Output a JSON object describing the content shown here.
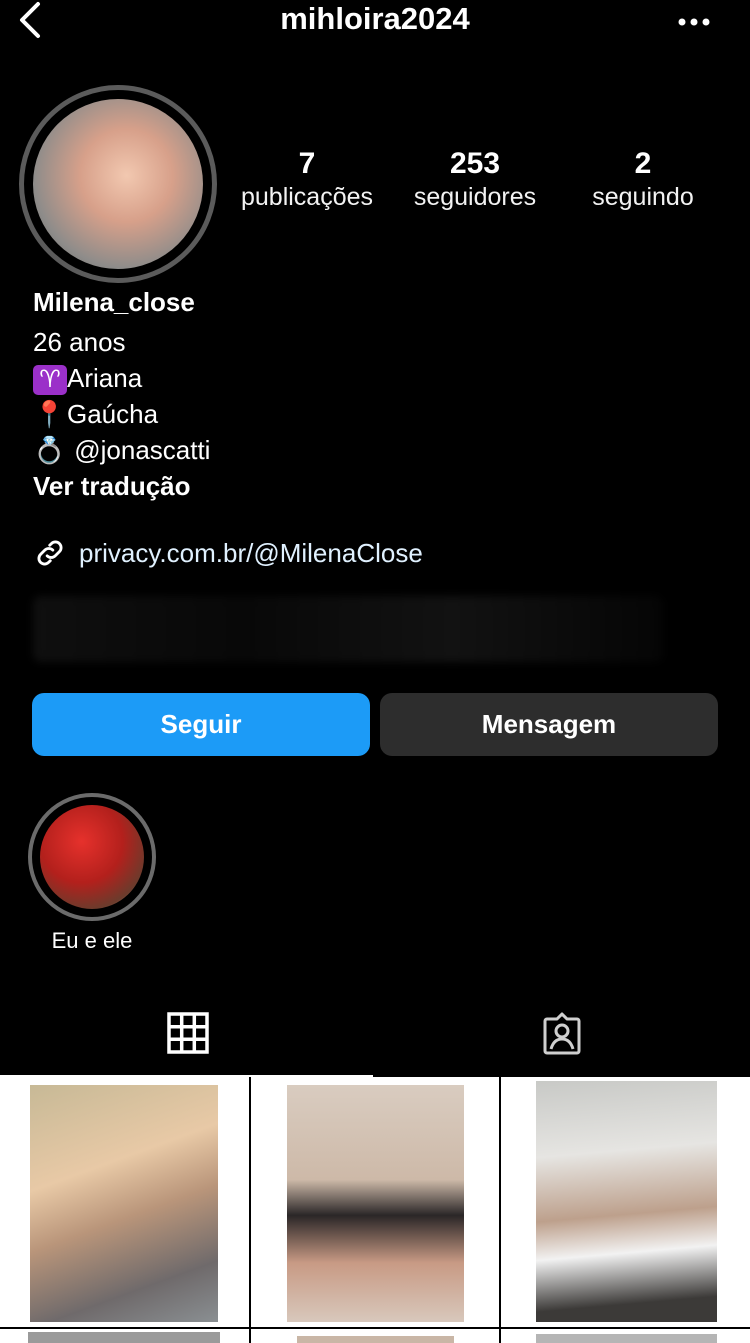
{
  "header": {
    "username": "mihloira2024",
    "back_icon": "chevron-left-icon",
    "more_icon": "more-horizontal-icon"
  },
  "stats": [
    {
      "value": "7",
      "label": "publicações"
    },
    {
      "value": "253",
      "label": "seguidores"
    },
    {
      "value": "2",
      "label": "seguindo"
    }
  ],
  "bio": {
    "name": "Milena_close",
    "age": "26 anos",
    "sign_emoji": "♈",
    "sign": "Ariana",
    "location_emoji": "📍",
    "location": "Gaúcha",
    "ring_emoji": "💍",
    "partner": " @jonascatti",
    "translate": "Ver tradução"
  },
  "link": {
    "text": "privacy.com.br/@MilenaClose",
    "icon": "link-icon"
  },
  "actions": {
    "follow": "Seguir",
    "message": "Mensagem"
  },
  "highlights": [
    {
      "label": "Eu e ele"
    }
  ],
  "tabs": {
    "posts_icon": "grid-icon",
    "tagged_icon": "tagged-person-icon"
  },
  "colors": {
    "background": "#000000",
    "follow_button": "#1c9bf7",
    "message_button": "#2d2d2d"
  }
}
